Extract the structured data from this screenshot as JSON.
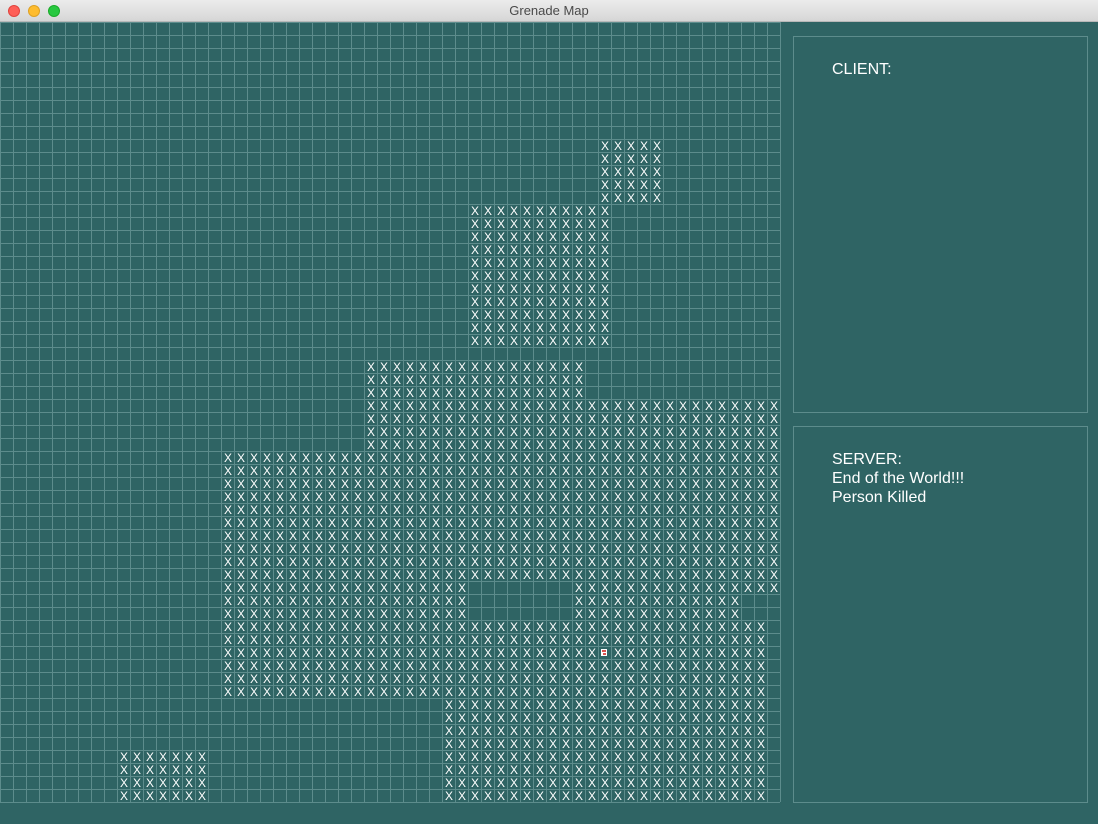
{
  "window": {
    "title": "Grenade Map"
  },
  "colors": {
    "background": "#2f6464",
    "grid_line": "#5d8c8c",
    "mark": "#ffffff",
    "red_marker": "#d9534f"
  },
  "grid": {
    "cols": 60,
    "rows": 60,
    "mark_glyph": "X",
    "blocks": [
      {
        "c0": 46,
        "c1": 50,
        "r0": 9,
        "r1": 13
      },
      {
        "c0": 36,
        "c1": 46,
        "r0": 14,
        "r1": 24
      },
      {
        "c0": 28,
        "c1": 44,
        "r0": 26,
        "r1": 42
      },
      {
        "c0": 44,
        "c1": 59,
        "r0": 29,
        "r1": 43
      },
      {
        "c0": 17,
        "c1": 27,
        "r0": 33,
        "r1": 51
      },
      {
        "c0": 28,
        "c1": 35,
        "r0": 43,
        "r1": 51
      },
      {
        "c0": 44,
        "c1": 56,
        "r0": 44,
        "r1": 45
      },
      {
        "c0": 36,
        "c1": 58,
        "r0": 46,
        "r1": 59
      },
      {
        "c0": 34,
        "c1": 35,
        "r0": 52,
        "r1": 59
      },
      {
        "c0": 9,
        "c1": 15,
        "r0": 56,
        "r1": 59
      }
    ],
    "red_cell": {
      "c": 46,
      "r": 48
    }
  },
  "client": {
    "lines": [
      "CLIENT:"
    ]
  },
  "server": {
    "lines": [
      "SERVER:",
      "End of the World!!!",
      "Person Killed"
    ]
  }
}
